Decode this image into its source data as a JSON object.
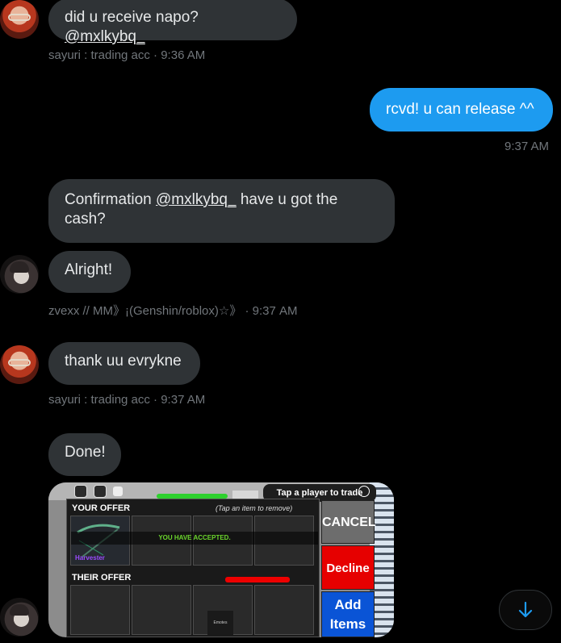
{
  "messages": [
    {
      "sender": "sayuri",
      "prefix": "did u receive napo? ",
      "mention": "@mxlkybq_"
    },
    {
      "sender": "sayuri",
      "meta": "sayuri : trading acc · 9:36 AM"
    },
    {
      "sender": "me",
      "text": "rcvd! u can release ^^",
      "meta": "9:37 AM"
    },
    {
      "sender": "zvexx",
      "prefix": "Confirmation ",
      "mention": "@mxlkybq_",
      "suffix": " have u got the cash?"
    },
    {
      "sender": "zvexx",
      "text": "Alright!",
      "meta": "zvexx // MM》¡(Genshin/roblox)☆》 · 9:37 AM"
    },
    {
      "sender": "sayuri",
      "text": "thank uu evrykne",
      "meta": "sayuri : trading acc · 9:37 AM"
    },
    {
      "sender": "zvexx",
      "text": "Done!"
    }
  ],
  "game": {
    "tap_text": "Tap a player to trade",
    "your_offer": "YOUR OFFER",
    "remove_hint": "(Tap an item to remove)",
    "accepted": "YOU HAVE ACCEPTED.",
    "item_name": "Harvester",
    "their_offer": "THEIR OFFER",
    "emotes": "Emotes",
    "cancel": "CANCEL",
    "decline": "Decline",
    "add_items": "Add Items"
  },
  "icons": {
    "scroll_down": "arrow-down-icon"
  },
  "colors": {
    "outgoing_bubble": "#1d9bf0",
    "incoming_bubble": "#2f3336",
    "link_blue": "#1d9bf0"
  }
}
